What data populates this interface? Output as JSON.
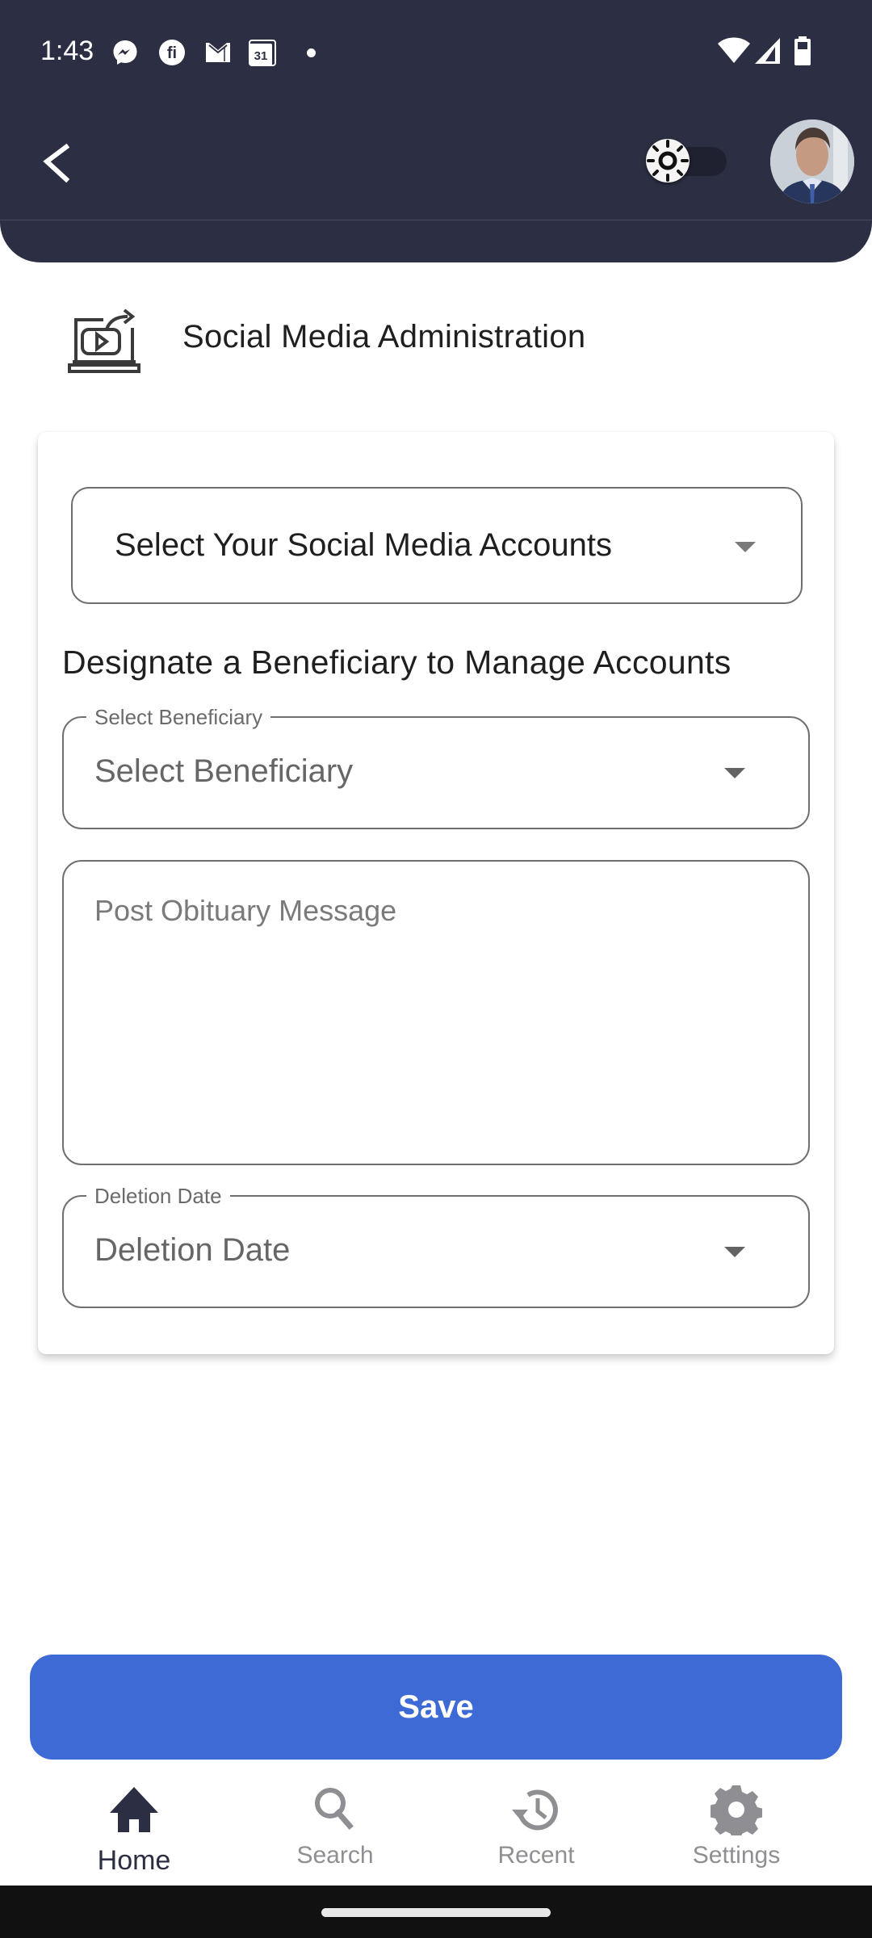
{
  "status_bar": {
    "time": "1:43",
    "notification_icons": [
      "messenger-icon",
      "fi-app-icon",
      "gmail-icon",
      "calendar-icon"
    ],
    "calendar_day": "31",
    "system_icons": [
      "wifi-icon",
      "signal-icon",
      "battery-icon"
    ]
  },
  "header": {
    "back_icon": "chevron-left-icon",
    "theme_toggle": {
      "icon": "sun-icon",
      "state": "light"
    },
    "avatar_alt": "User profile photo"
  },
  "page": {
    "title": "Social Media Administration",
    "icon": "laptop-video-share-icon"
  },
  "form": {
    "accounts_select": {
      "value": "Select Your Social Media Accounts"
    },
    "section_heading": "Designate a Beneficiary to Manage Accounts",
    "beneficiary_select": {
      "label": "Select Beneficiary",
      "value": "Select Beneficiary"
    },
    "obituary_message": {
      "placeholder": "Post Obituary Message",
      "value": ""
    },
    "deletion_date": {
      "label": "Deletion Date",
      "value": "Deletion Date"
    }
  },
  "actions": {
    "save_label": "Save"
  },
  "bottom_nav": {
    "active": "Home",
    "items": [
      {
        "label": "Home",
        "icon": "home-icon"
      },
      {
        "label": "Search",
        "icon": "search-icon"
      },
      {
        "label": "Recent",
        "icon": "history-icon"
      },
      {
        "label": "Settings",
        "icon": "gear-icon"
      }
    ]
  },
  "colors": {
    "header_bg": "#2c2f43",
    "primary": "#3d6ad4",
    "nav_active": "#2c2f43",
    "nav_inactive": "#8f8f93"
  }
}
